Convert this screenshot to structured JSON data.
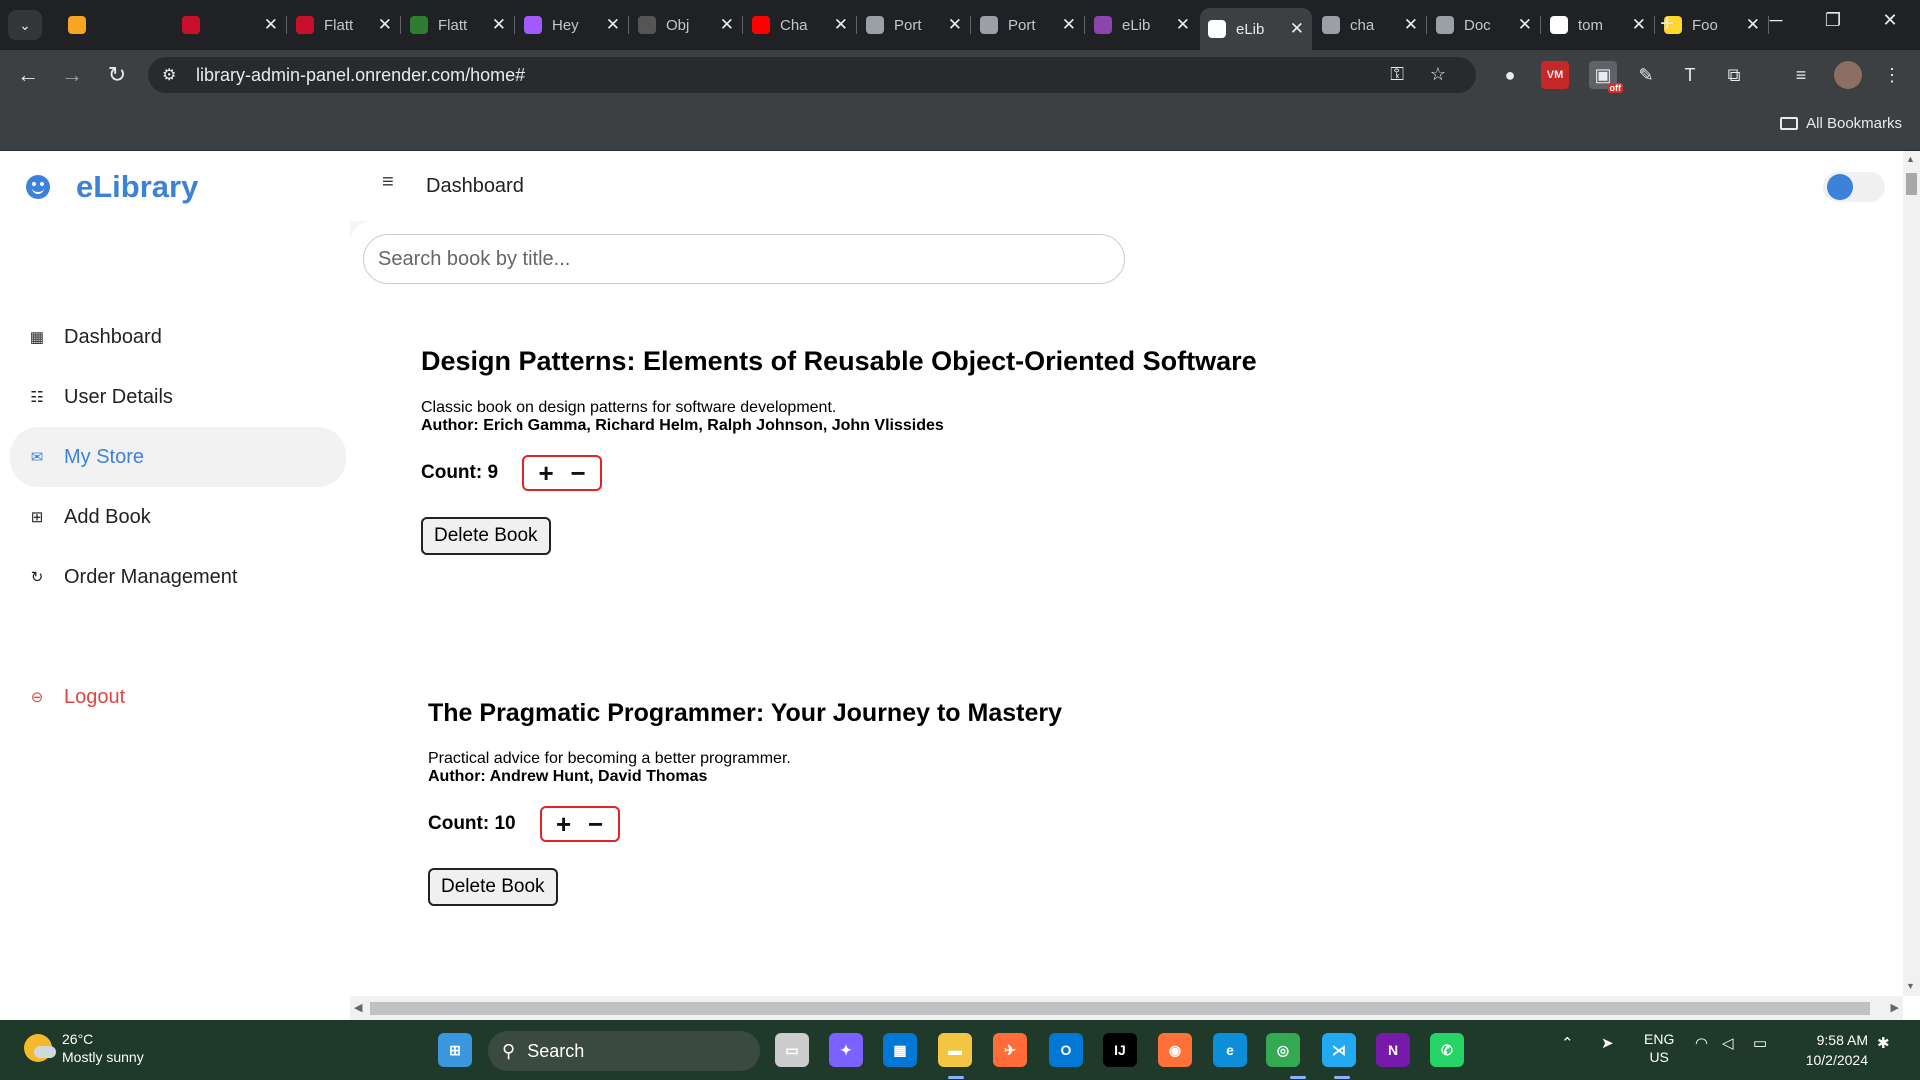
{
  "browser": {
    "tabs": [
      {
        "label": "",
        "icon": "arrow-icon",
        "color": "#f5a623"
      },
      {
        "label": "",
        "icon": "tup-icon",
        "color": "#c8102e"
      },
      {
        "label": "Flatt",
        "icon": "tup-icon",
        "color": "#c8102e"
      },
      {
        "label": "Flatt",
        "icon": "flatiron-icon",
        "color": "#2e7d32"
      },
      {
        "label": "Hey",
        "icon": "figma-icon",
        "color": "#a259ff"
      },
      {
        "label": "Obj",
        "icon": "openai-icon",
        "color": "#555555"
      },
      {
        "label": "Cha",
        "icon": "youtube-icon",
        "color": "#ff0000"
      },
      {
        "label": "Port",
        "icon": "globe-icon",
        "color": "#9aa0a6"
      },
      {
        "label": "Port",
        "icon": "globe-icon",
        "color": "#9aa0a6"
      },
      {
        "label": "eLib",
        "icon": "elibrary-icon",
        "color": "#8e44ad"
      },
      {
        "label": "eLib",
        "icon": "elibrary-icon",
        "color": "#ffffff",
        "active": true
      },
      {
        "label": "cha",
        "icon": "globe-icon",
        "color": "#9aa0a6"
      },
      {
        "label": "Doc",
        "icon": "globe-icon",
        "color": "#9aa0a6"
      },
      {
        "label": "tom",
        "icon": "link-icon",
        "color": "#ffffff"
      },
      {
        "label": "Foo",
        "icon": "vite-icon",
        "color": "#ffd62e"
      }
    ],
    "url": "library-admin-panel.onrender.com/home#",
    "bookmarks_label": "All Bookmarks",
    "ext_off_badge": "off"
  },
  "app": {
    "brand": "eLibrary",
    "page_title": "Dashboard",
    "accent_color": "#3c82d9",
    "sidebar": [
      {
        "label": "Dashboard",
        "icon": "dashboard-icon",
        "active": false
      },
      {
        "label": "User Details",
        "icon": "users-icon",
        "active": false
      },
      {
        "label": "My Store",
        "icon": "store-icon",
        "active": true
      },
      {
        "label": "Add Book",
        "icon": "add-book-icon",
        "active": false
      },
      {
        "label": "Order Management",
        "icon": "orders-icon",
        "active": false
      }
    ],
    "logout_label": "Logout",
    "search_placeholder": "Search book by title...",
    "books": [
      {
        "title": "Design Patterns: Elements of Reusable Object-Oriented Software",
        "description": "Classic book on design patterns for software development.",
        "author": "Author: Erich Gamma, Richard Helm, Ralph Johnson, John Vlissides",
        "count": "Count: 9",
        "delete_label": "Delete Book"
      },
      {
        "title": "The Pragmatic Programmer: Your Journey to Mastery",
        "description": "Practical advice for becoming a better programmer.",
        "author": "Author: Andrew Hunt, David Thomas",
        "count": "Count: 10",
        "delete_label": "Delete Book"
      }
    ],
    "stepper": {
      "plus": "+",
      "minus": "−"
    }
  },
  "taskbar": {
    "weather_temp": "26°C",
    "weather_desc": "Mostly sunny",
    "search_label": "Search",
    "lang_top": "ENG",
    "lang_bottom": "US",
    "time": "9:58 AM",
    "date": "10/2/2024",
    "apps": [
      {
        "name": "start-icon",
        "color": "#3a96dd"
      },
      {
        "name": "task-view-icon",
        "color": "#cccccc"
      },
      {
        "name": "copilot-icon",
        "color": "#7b61ff"
      },
      {
        "name": "store-app-icon",
        "color": "#0078d4"
      },
      {
        "name": "file-explorer-icon",
        "color": "#f4c542"
      },
      {
        "name": "postman-icon",
        "color": "#ff6c37"
      },
      {
        "name": "outlook-icon",
        "color": "#0078d4"
      },
      {
        "name": "intellij-icon",
        "color": "#000000"
      },
      {
        "name": "firefox-icon",
        "color": "#ff7139"
      },
      {
        "name": "edge-icon",
        "color": "#0c8ed9"
      },
      {
        "name": "chrome-icon",
        "color": "#34a853"
      },
      {
        "name": "vscode-icon",
        "color": "#23a9f2"
      },
      {
        "name": "onenote-icon",
        "color": "#7719aa"
      },
      {
        "name": "whatsapp-icon",
        "color": "#25d366"
      }
    ]
  }
}
